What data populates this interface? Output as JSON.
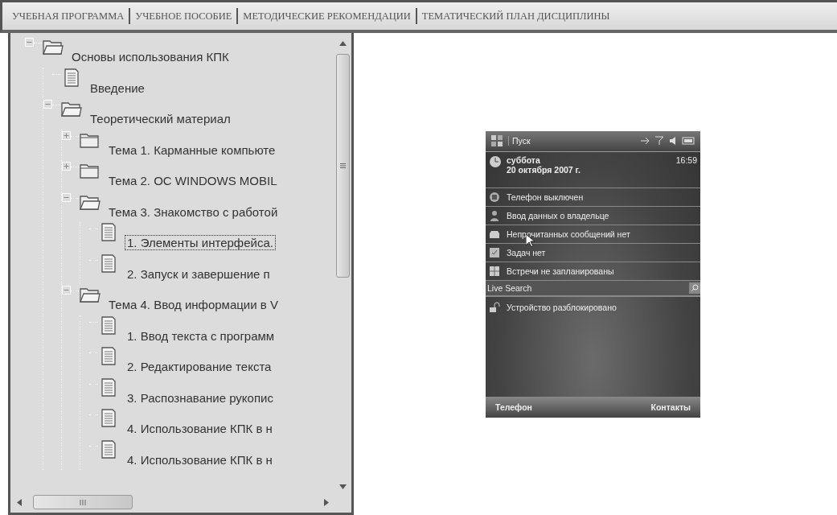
{
  "nav": [
    "УЧЕБНАЯ ПРОГРАММА",
    "УЧЕБНОЕ ПОСОБИЕ",
    "МЕТОДИЧЕСКИЕ РЕКОМЕНДАЦИИ",
    "ТЕМАТИЧЕСКИЙ ПЛАН ДИСЦИПЛИНЫ"
  ],
  "tree": [
    {
      "kind": "folder",
      "label": "Основы использования КПК",
      "expanded": true,
      "selected": false,
      "children": [
        {
          "kind": "document",
          "label": "Введение",
          "selected": false
        },
        {
          "kind": "folder",
          "label": "Теоретический материал",
          "expanded": true,
          "selected": false,
          "children": [
            {
              "kind": "folder",
              "label": "Тема 1. Карманные компьюте",
              "expanded": false,
              "selected": false
            },
            {
              "kind": "folder",
              "label": "Тема 2. ОС WINDOWS MOBIL",
              "expanded": false,
              "selected": false
            },
            {
              "kind": "folder",
              "label": "Тема 3. Знакомство с работой",
              "expanded": true,
              "selected": false,
              "children": [
                {
                  "kind": "document",
                  "label": "1. Элементы интерфейса.",
                  "selected": true
                },
                {
                  "kind": "document",
                  "label": "2. Запуск и завершение п",
                  "selected": false
                }
              ]
            },
            {
              "kind": "folder",
              "label": "Тема 4. Ввод информации в V",
              "expanded": true,
              "selected": false,
              "children": [
                {
                  "kind": "document",
                  "label": "1. Ввод текста с программ",
                  "selected": false
                },
                {
                  "kind": "document",
                  "label": "2. Редактирование текста",
                  "selected": false
                },
                {
                  "kind": "document",
                  "label": "3. Распознавание рукопис",
                  "selected": false
                },
                {
                  "kind": "document",
                  "label": "4. Использование КПК в н",
                  "selected": false
                },
                {
                  "kind": "document",
                  "label": "4. Использование КПК в н",
                  "selected": false
                }
              ]
            }
          ]
        }
      ]
    }
  ],
  "phone": {
    "start": "Пуск",
    "day": "суббота",
    "date": "20 октября 2007 г.",
    "time": "16:59",
    "items": [
      {
        "kind": "phone",
        "text": "Телефон выключен"
      },
      {
        "kind": "owner",
        "text": "Ввод данных о владельце"
      },
      {
        "kind": "mail",
        "text": "Непрочитанных сообщений нет"
      },
      {
        "kind": "tasks",
        "text": "Задач нет"
      },
      {
        "kind": "calendar",
        "text": "Встречи не запланированы"
      }
    ],
    "search": {
      "value": "Live Search"
    },
    "status": "Устройство разблокировано",
    "softkeys": [
      "Телефон",
      "Контакты"
    ]
  }
}
